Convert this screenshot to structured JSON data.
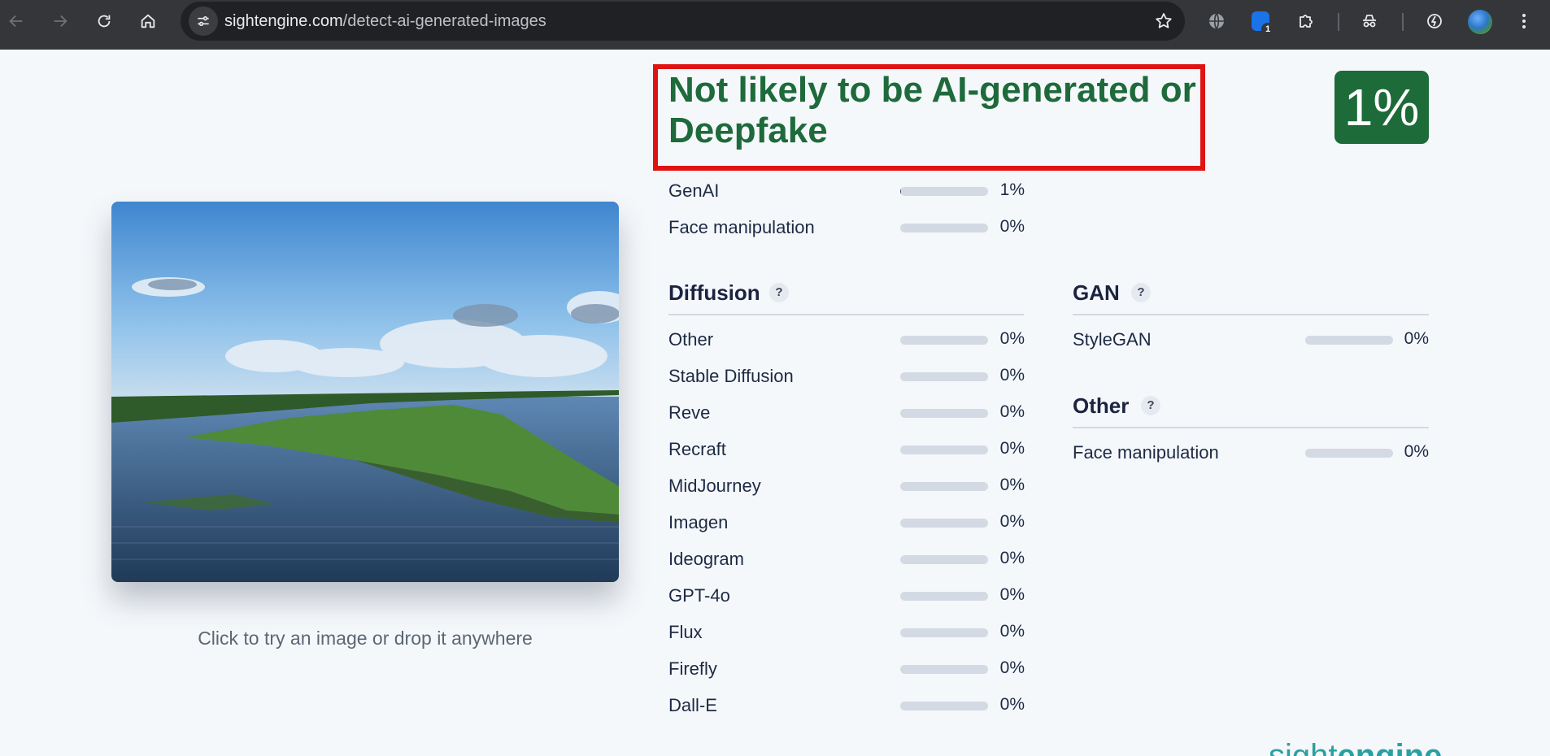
{
  "browser": {
    "url_host": "sightengine.com",
    "url_path": "/detect-ai-generated-images",
    "extension_badge": "1",
    "icons": [
      "back-arrow-icon",
      "forward-arrow-icon",
      "reload-icon",
      "home-icon",
      "site-info-icon",
      "bookmark-star-icon",
      "translate-globe-icon",
      "extension-icon",
      "puzzle-icon",
      "incognito-icon",
      "performance-icon",
      "profile-avatar",
      "kebab-menu-icon"
    ]
  },
  "upload": {
    "caption": "Click to try an image or drop it anywhere"
  },
  "result": {
    "verdict": "Not likely to be AI-generated or Deepfake",
    "score": "1%",
    "score_color": "#1d6b38",
    "verdict_color": "#1e6a3b",
    "highlight_color": "#e01313",
    "summary": [
      {
        "label": "GenAI",
        "pct": "1%",
        "value": 1
      },
      {
        "label": "Face manipulation",
        "pct": "0%",
        "value": 0
      }
    ],
    "diffusion": {
      "title": "Diffusion",
      "help": "?",
      "items": [
        {
          "label": "Other",
          "pct": "0%",
          "value": 0
        },
        {
          "label": "Stable Diffusion",
          "pct": "0%",
          "value": 0
        },
        {
          "label": "Reve",
          "pct": "0%",
          "value": 0
        },
        {
          "label": "Recraft",
          "pct": "0%",
          "value": 0
        },
        {
          "label": "MidJourney",
          "pct": "0%",
          "value": 0
        },
        {
          "label": "Imagen",
          "pct": "0%",
          "value": 0
        },
        {
          "label": "Ideogram",
          "pct": "0%",
          "value": 0
        },
        {
          "label": "GPT-4o",
          "pct": "0%",
          "value": 0
        },
        {
          "label": "Flux",
          "pct": "0%",
          "value": 0
        },
        {
          "label": "Firefly",
          "pct": "0%",
          "value": 0
        },
        {
          "label": "Dall-E",
          "pct": "0%",
          "value": 0
        }
      ]
    },
    "gan": {
      "title": "GAN",
      "help": "?",
      "items": [
        {
          "label": "StyleGAN",
          "pct": "0%",
          "value": 0
        }
      ]
    },
    "other": {
      "title": "Other",
      "help": "?",
      "items": [
        {
          "label": "Face manipulation",
          "pct": "0%",
          "value": 0
        }
      ]
    }
  },
  "brand": {
    "part1": "sight",
    "part2": "engine"
  }
}
